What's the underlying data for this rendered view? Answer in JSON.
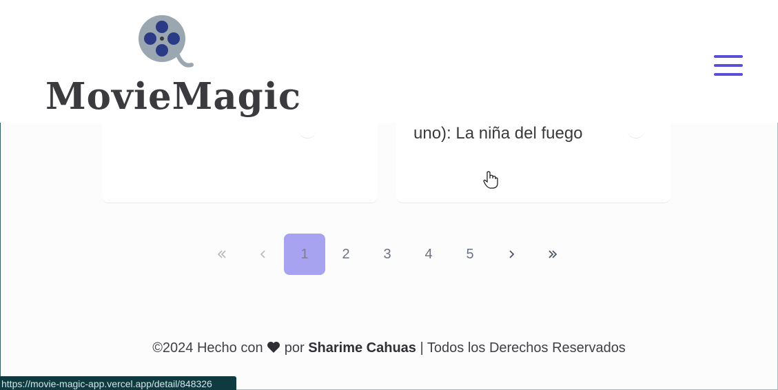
{
  "header": {
    "brand": "MovieMagic",
    "menu_icon": "hamburger-menu-icon",
    "accent_color": "#5b4fd6"
  },
  "cards": [
    {
      "title": ""
    },
    {
      "title": "uno): La niña del fuego"
    }
  ],
  "pagination": {
    "first_icon": "double-chevron-left-icon",
    "prev_icon": "chevron-left-icon",
    "pages": [
      "1",
      "2",
      "3",
      "4",
      "5"
    ],
    "current": "1",
    "next_icon": "chevron-right-icon",
    "last_icon": "double-chevron-right-icon",
    "active_color": "#a7a3f0"
  },
  "footer": {
    "prefix": "©2024 Hecho con",
    "por": "por",
    "author": "Sharime Cahuas",
    "rights": "Todos los Derechos Reservados"
  },
  "status_bar": {
    "url": "https://movie-magic-app.vercel.app/detail/848326"
  }
}
